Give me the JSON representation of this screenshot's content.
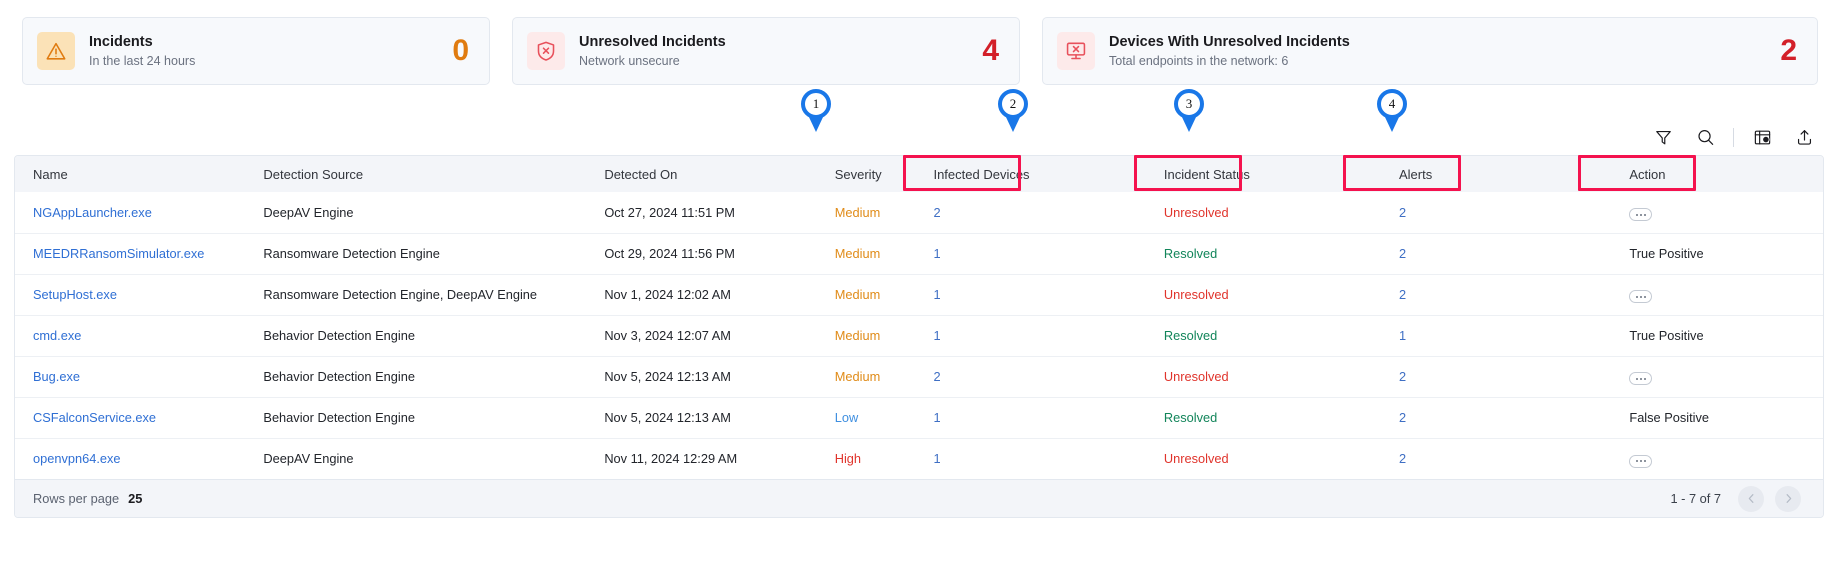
{
  "cards": [
    {
      "icon": "warning-triangle-icon",
      "icon_style": "amber",
      "title": "Incidents",
      "subtitle": "In the last 24 hours",
      "value": "0",
      "value_color": "#e07b10"
    },
    {
      "icon": "shield-x-icon",
      "icon_style": "rose",
      "title": "Unresolved Incidents",
      "subtitle": "Network unsecure",
      "value": "4",
      "value_color": "#d32029"
    },
    {
      "icon": "monitor-x-icon",
      "icon_style": "rose",
      "title": "Devices With Unresolved Incidents",
      "subtitle": "Total endpoints in the network: 6",
      "value": "2",
      "value_color": "#d32029"
    }
  ],
  "toolbar": {
    "filter_icon": "filter-funnel-icon",
    "search_icon": "search-icon",
    "columns_icon": "table-columns-settings-icon",
    "export_icon": "export-upload-icon"
  },
  "table": {
    "headers": [
      "Name",
      "Detection Source",
      "Detected On",
      "Severity",
      "Infected Devices",
      "Incident Status",
      "Alerts",
      "Action"
    ],
    "rows": [
      {
        "name": "NGAppLauncher.exe",
        "source": "DeepAV Engine",
        "detected_on": "Oct 27, 2024 11:51 PM",
        "severity": "Medium",
        "infected_devices": "2",
        "status": "Unresolved",
        "alerts": "2",
        "action": "",
        "action_type": "menu"
      },
      {
        "name": "MEEDRRansomSimulator.exe",
        "source": "Ransomware Detection Engine",
        "detected_on": "Oct 29, 2024 11:56 PM",
        "severity": "Medium",
        "infected_devices": "1",
        "status": "Resolved",
        "alerts": "2",
        "action": "True Positive",
        "action_type": "text"
      },
      {
        "name": "SetupHost.exe",
        "source": "Ransomware Detection Engine, DeepAV Engine",
        "detected_on": "Nov 1, 2024 12:02 AM",
        "severity": "Medium",
        "infected_devices": "1",
        "status": "Unresolved",
        "alerts": "2",
        "action": "",
        "action_type": "menu"
      },
      {
        "name": "cmd.exe",
        "source": "Behavior Detection Engine",
        "detected_on": "Nov 3, 2024 12:07 AM",
        "severity": "Medium",
        "infected_devices": "1",
        "status": "Resolved",
        "alerts": "1",
        "action": "True Positive",
        "action_type": "text"
      },
      {
        "name": "Bug.exe",
        "source": "Behavior Detection Engine",
        "detected_on": "Nov 5, 2024 12:13 AM",
        "severity": "Medium",
        "infected_devices": "2",
        "status": "Unresolved",
        "alerts": "2",
        "action": "",
        "action_type": "menu"
      },
      {
        "name": "CSFalconService.exe",
        "source": "Behavior Detection Engine",
        "detected_on": "Nov 5, 2024 12:13 AM",
        "severity": "Low",
        "infected_devices": "1",
        "status": "Resolved",
        "alerts": "2",
        "action": "False Positive",
        "action_type": "text"
      },
      {
        "name": "openvpn64.exe",
        "source": "DeepAV Engine",
        "detected_on": "Nov 11, 2024 12:29 AM",
        "severity": "High",
        "infected_devices": "1",
        "status": "Unresolved",
        "alerts": "2",
        "action": "",
        "action_type": "menu"
      }
    ]
  },
  "footer": {
    "rows_per_page_label": "Rows per page",
    "rows_per_page_value": "25",
    "range": "1 - 7 of 7",
    "prev_icon": "chevron-left-icon",
    "next_icon": "chevron-right-icon"
  },
  "annotations": {
    "marker_color": "#1977e8",
    "box_color": "#f4124e",
    "pins": [
      {
        "number": "1",
        "target": "Infected Devices"
      },
      {
        "number": "2",
        "target": "Incident Status"
      },
      {
        "number": "3",
        "target": "Alerts"
      },
      {
        "number": "4",
        "target": "Action"
      }
    ]
  }
}
